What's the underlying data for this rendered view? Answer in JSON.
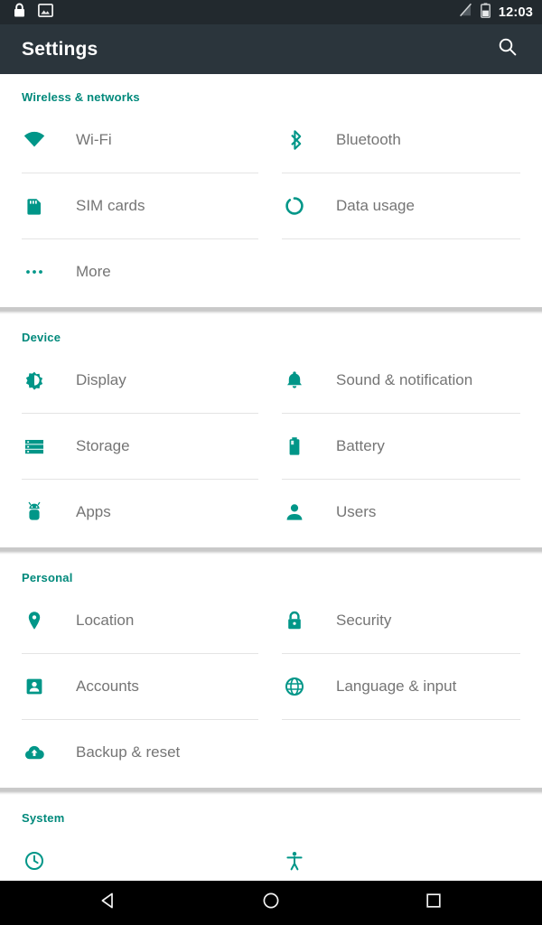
{
  "statusbar": {
    "time": "12:03",
    "left_icons": [
      {
        "name": "lock-icon",
        "label": "Screen locked"
      },
      {
        "name": "screenshot-image-icon",
        "label": "Screenshot captured"
      }
    ],
    "right_icons": [
      {
        "name": "signal-off-icon",
        "label": "No signal"
      },
      {
        "name": "battery-icon",
        "label": "Battery half"
      }
    ]
  },
  "appbar": {
    "title": "Settings",
    "search_icon": "search-icon"
  },
  "colors": {
    "accent": "#009688",
    "section_header": "#00897b",
    "appbar_bg": "#2b353c",
    "statusbar_bg": "#22292e",
    "label_text": "#757575",
    "divider": "#e4e4e4",
    "navbar_bg": "#000000"
  },
  "sections": [
    {
      "title": "Wireless & networks",
      "items": [
        {
          "label": "Wi-Fi",
          "icon": "wifi-icon"
        },
        {
          "label": "Bluetooth",
          "icon": "bluetooth-icon"
        },
        {
          "label": "SIM cards",
          "icon": "sim-card-icon"
        },
        {
          "label": "Data usage",
          "icon": "data-usage-icon"
        },
        {
          "label": "More",
          "icon": "more-dots-icon"
        }
      ]
    },
    {
      "title": "Device",
      "items": [
        {
          "label": "Display",
          "icon": "brightness-icon"
        },
        {
          "label": "Sound & notification",
          "icon": "bell-icon"
        },
        {
          "label": "Storage",
          "icon": "storage-icon"
        },
        {
          "label": "Battery",
          "icon": "battery-full-icon"
        },
        {
          "label": "Apps",
          "icon": "android-robot-icon"
        },
        {
          "label": "Users",
          "icon": "person-icon"
        }
      ]
    },
    {
      "title": "Personal",
      "items": [
        {
          "label": "Location",
          "icon": "location-pin-icon"
        },
        {
          "label": "Security",
          "icon": "padlock-icon"
        },
        {
          "label": "Accounts",
          "icon": "account-card-icon"
        },
        {
          "label": "Language & input",
          "icon": "globe-icon"
        },
        {
          "label": "Backup & reset",
          "icon": "cloud-upload-icon"
        }
      ]
    },
    {
      "title": "System",
      "items": []
    }
  ],
  "navbar": {
    "back": "back-triangle-icon",
    "home": "home-circle-icon",
    "recents": "recents-square-icon"
  }
}
